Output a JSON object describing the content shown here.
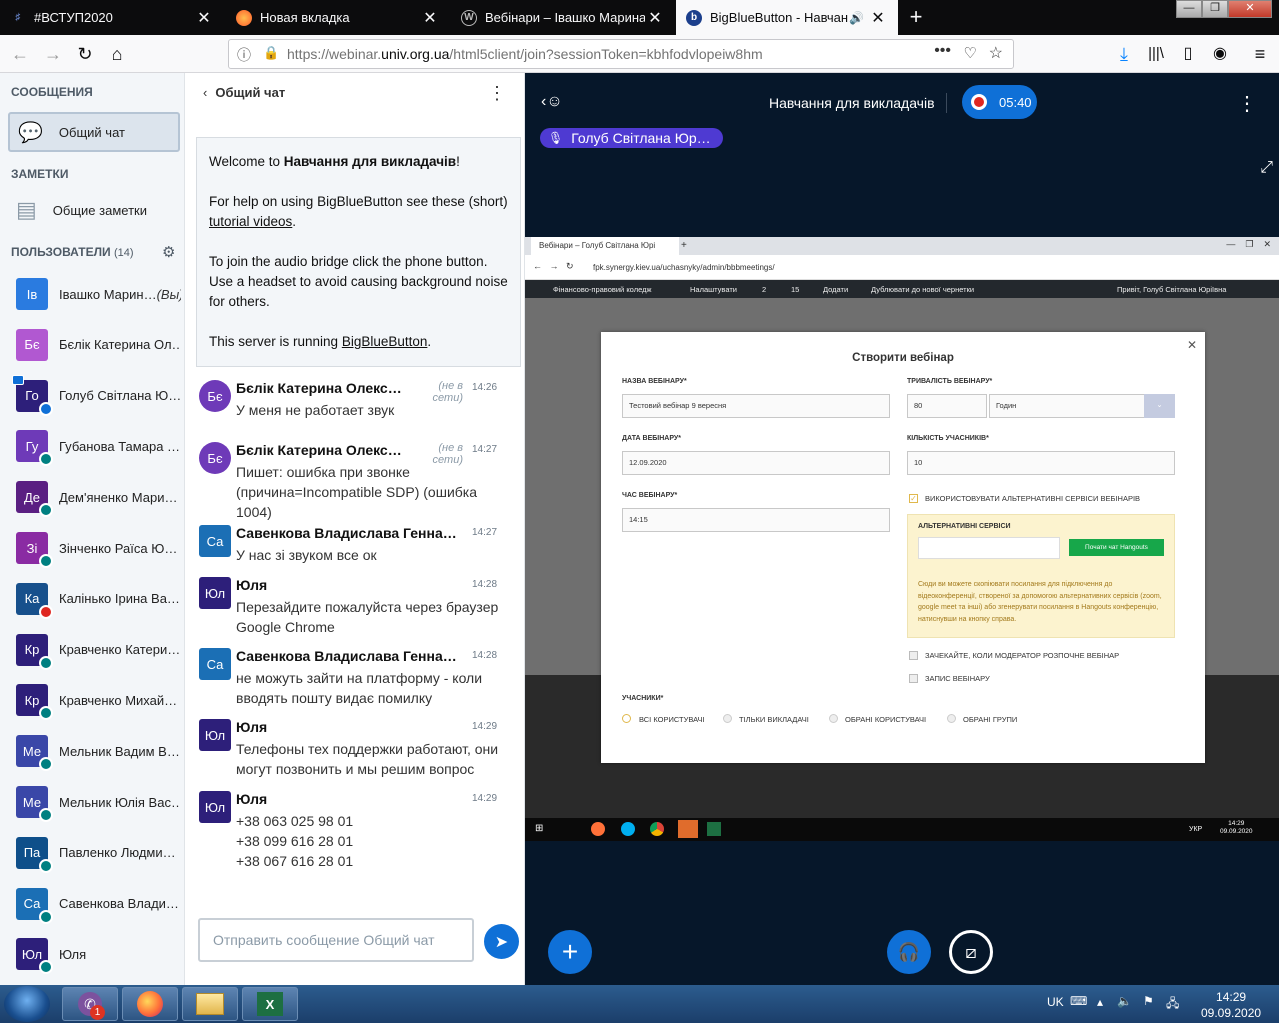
{
  "browser": {
    "tabs": [
      {
        "title": "#ВСТУП2020",
        "icon": "hash-icon"
      },
      {
        "title": "Новая вкладка",
        "icon": "firefox-icon"
      },
      {
        "title": "Вебінари – Івашко Марина Ва",
        "icon": "wordpress-icon"
      },
      {
        "title": "BigBlueButton - Навчання д",
        "icon": "bbb-icon",
        "active": true
      }
    ],
    "url_prefix": "https://webinar.",
    "url_domain": "univ.org.ua",
    "url_suffix": "/html5client/join?sessionToken=kbhfodvlopeiw8hm",
    "window_controls": [
      "—",
      "❐",
      "✕"
    ]
  },
  "sidebar": {
    "messages_title": "СООБЩЕНИЯ",
    "public_chat": "Общий чат",
    "notes_title": "ЗАМЕТКИ",
    "shared_notes": "Общие заметки",
    "users_title": "ПОЛЬЗОВАТЕЛИ",
    "users_count": "(14)",
    "users": [
      {
        "initials": "Ів",
        "name": "Івашко Марин…",
        "you": "(Вы)",
        "color": "#2a7be0",
        "badge": "none"
      },
      {
        "initials": "Бє",
        "name": "Бєлік Катерина Ол…",
        "color": "#b158d1",
        "badge": "none"
      },
      {
        "initials": "Го",
        "name": "Голуб Світлана Ю…",
        "color": "#2d1f7a",
        "badge": "blue",
        "presenter": true
      },
      {
        "initials": "Гу",
        "name": "Губанова Тамара …",
        "color": "#6e3ab8",
        "badge": "green"
      },
      {
        "initials": "Де",
        "name": "Дем'яненко Мари…",
        "color": "#5a1f82",
        "badge": "green"
      },
      {
        "initials": "Зі",
        "name": "Зінченко Раїса Ю…",
        "color": "#8a2ba3",
        "badge": "green"
      },
      {
        "initials": "Ка",
        "name": "Калінько Ірина Ва…",
        "color": "#17508c",
        "badge": "red"
      },
      {
        "initials": "Кр",
        "name": "Кравченко Катери…",
        "color": "#2d1f7a",
        "badge": "green"
      },
      {
        "initials": "Кр",
        "name": "Кравченко Михай…",
        "color": "#2d1f7a",
        "badge": "green"
      },
      {
        "initials": "Ме",
        "name": "Мельник Вадим В…",
        "color": "#3a47a8",
        "badge": "green"
      },
      {
        "initials": "Ме",
        "name": "Мельник Юлія Вас…",
        "color": "#3a47a8",
        "badge": "green"
      },
      {
        "initials": "Па",
        "name": "Павленко Людми…",
        "color": "#0e4f8a",
        "badge": "green"
      },
      {
        "initials": "Са",
        "name": "Савенкова Влади…",
        "color": "#1b6fb5",
        "badge": "green"
      },
      {
        "initials": "Юл",
        "name": "Юля",
        "color": "#2d1f7a",
        "badge": "green"
      }
    ]
  },
  "chat": {
    "header": "Общий чат",
    "welcome": {
      "line1_pre": "Welcome to ",
      "line1_bold": "Навчання для викладачів",
      "line1_post": "!",
      "line2_pre": "For help on using BigBlueButton see these (short) ",
      "line2_link": "tutorial videos",
      "line2_post": ".",
      "line3": "To join the audio bridge click the phone button. Use a headset to avoid causing background noise for others.",
      "line4_pre": "This server is running ",
      "line4_link": "BigBlueButton",
      "line4_post": "."
    },
    "messages": [
      {
        "initials": "Бє",
        "name": "Бєлік Катерина Олекс…",
        "offline": "(не в сети)",
        "time": "14:26",
        "text": "У меня не работает звук",
        "color": "#6e3ab8",
        "round": true
      },
      {
        "initials": "Бє",
        "name": "Бєлік Катерина Олекс…",
        "offline": "(не в сети)",
        "time": "14:27",
        "text": "Пишет: ошибка при звонке (причина=Incompatible SDP) (ошибка 1004)",
        "color": "#6e3ab8",
        "round": true
      },
      {
        "initials": "Са",
        "name": "Савенкова Владислава Генна…",
        "time": "14:27",
        "text": "У нас зі звуком все ок",
        "color": "#1b6fb5"
      },
      {
        "initials": "Юл",
        "name": "Юля",
        "time": "14:28",
        "text": "Перезайдите пожалуйста через браузер Google Chrome",
        "color": "#2d1f7a"
      },
      {
        "initials": "Са",
        "name": "Савенкова Владислава Генна…",
        "time": "14:28",
        "text": "не можуть зайти на платформу - коли вводять пошту видає помилку",
        "color": "#1b6fb5"
      },
      {
        "initials": "Юл",
        "name": "Юля",
        "time": "14:29",
        "text": "Телефоны тех поддержки работают, они могут позвонить и мы решим вопрос",
        "color": "#2d1f7a"
      },
      {
        "initials": "Юл",
        "name": "Юля",
        "time": "14:29",
        "text": "+38 063 025 98 01\n+38 099 616 28 01\n+38 067 616 28 01",
        "color": "#2d1f7a"
      }
    ],
    "input_placeholder": "Отправить сообщение Общий чат"
  },
  "main": {
    "meeting_title": "Навчання для викладачів",
    "recording_time": "05:40",
    "talker": "Голуб Світлана Юр…"
  },
  "screenshare": {
    "tab_title": "Вебінари – Голуб Світлана Юрі",
    "url": "fpk.synergy.kiev.ua/uchasnyky/admin/bbbmeetings/",
    "wp_items": [
      "Фінансово-правовий коледж",
      "Налаштувати",
      "2",
      "15",
      "Додати",
      "Дублювати до нової чернетки"
    ],
    "wp_greeting": "Привіт, Голуб Світлана Юріївна",
    "modal": {
      "title": "Створити вебінар",
      "name_label": "НАЗВА ВЕБІНАРУ*",
      "name_value": "Тестовий вебінар 9 вересня",
      "duration_label": "ТРИВАЛІСТЬ ВЕБІНАРУ*",
      "duration_value": "80",
      "duration_unit": "Годин",
      "date_label": "ДАТА ВЕБІНАРУ*",
      "date_value": "12.09.2020",
      "count_label": "КІЛЬКІСТЬ УЧАСНИКІВ*",
      "count_value": "10",
      "time_label": "ЧАС ВЕБІНАРУ*",
      "time_value": "14:15",
      "alt_check": "ВИКОРИСТОВУВАТИ АЛЬТЕРНАТИВНІ СЕРВІСИ ВЕБІНАРІВ",
      "alt_title": "АЛЬТЕРНАТИВНІ СЕРВІСИ",
      "hangouts_btn": "Почати чат Hangouts",
      "alt_text": "Сюди ви можете скопіювати посилання для підключення до відеоконференції, створеної за допомогою альтернативних сервісів (zoom, google meet та інші) або згенерувати посилання в Hangouts конференцію, натиснувши на кнопку справа.",
      "wait_check": "ЗАЧЕКАЙТЕ, КОЛИ МОДЕРАТОР РОЗПОЧНЕ ВЕБІНАР",
      "record_check": "ЗАПИС ВЕБІНАРУ",
      "participants_label": "УЧАСНИКИ*",
      "radios": [
        "ВСІ КОРИСТУВАЧІ",
        "ТІЛЬКИ ВИКЛАДАЧІ",
        "ОБРАНІ КОРИСТУВАЧІ",
        "ОБРАНІ ГРУПИ"
      ]
    },
    "taskbar_lang": "УКР",
    "taskbar_time": "14:29",
    "taskbar_date": "09.09.2020"
  },
  "taskbar": {
    "lang": "UK",
    "time": "14:29",
    "date": "09.09.2020",
    "viber_badge": "1"
  }
}
